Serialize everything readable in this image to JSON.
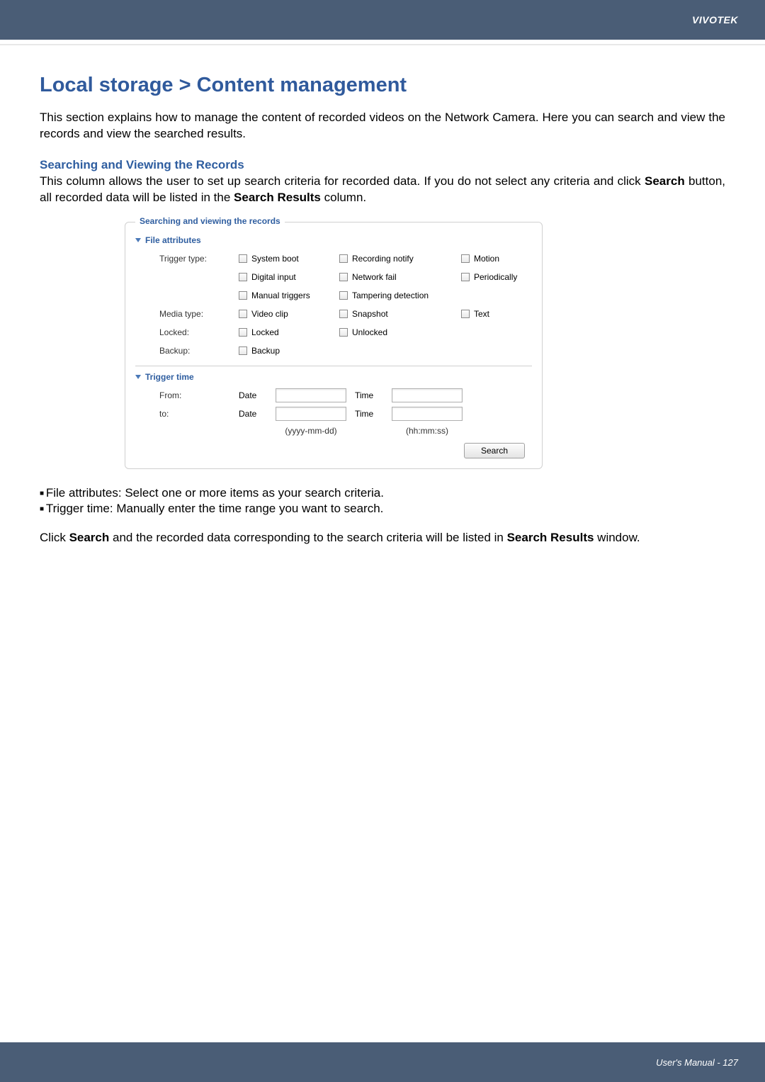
{
  "header": {
    "brand": "VIVOTEK"
  },
  "title": "Local storage > Content management",
  "intro": "This section explains how to manage the content of recorded videos on the Network Camera. Here you can search and view the records and view the searched results.",
  "search_section": {
    "heading": "Searching and Viewing the Records",
    "desc_pre": "This column allows the user to set up search criteria for recorded data. If you do not select any criteria and click ",
    "desc_mid1": "Search",
    "desc_mid2": " button, all recorded data will be listed in the ",
    "desc_mid3": "Search Results",
    "desc_post": " column."
  },
  "box": {
    "legend": "Searching and viewing the records",
    "file_attributes": "File attributes",
    "trigger_type_label": "Trigger type:",
    "triggers": {
      "system_boot": "System boot",
      "recording_notify": "Recording notify",
      "motion": "Motion",
      "digital_input": "Digital input",
      "network_fail": "Network fail",
      "periodically": "Periodically",
      "manual_triggers": "Manual triggers",
      "tampering_detection": "Tampering detection"
    },
    "media_type_label": "Media type:",
    "media": {
      "video_clip": "Video clip",
      "snapshot": "Snapshot",
      "text": "Text"
    },
    "locked_label": "Locked:",
    "locked": {
      "locked": "Locked",
      "unlocked": "Unlocked"
    },
    "backup_label": "Backup:",
    "backup": {
      "backup": "Backup"
    },
    "trigger_time_label": "Trigger time",
    "from_label": "From:",
    "to_label": "to:",
    "date_label": "Date",
    "time_label": "Time",
    "date_hint": "(yyyy-mm-dd)",
    "time_hint": "(hh:mm:ss)",
    "search_btn": "Search"
  },
  "bullets": {
    "b1": "File attributes: Select one or more items as your search criteria.",
    "b2": "Trigger time: Manually enter the time range you want to search."
  },
  "closing": {
    "pre": "Click ",
    "b1": "Search",
    "mid": " and the recorded data corresponding to the search criteria will be listed in ",
    "b2": "Search Results",
    "post": " window."
  },
  "footer": {
    "text": "User's Manual - 127"
  }
}
